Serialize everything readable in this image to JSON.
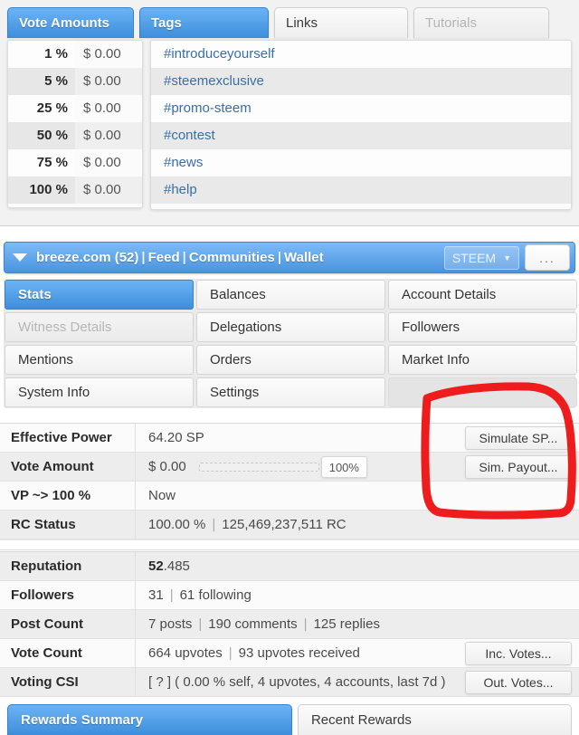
{
  "top_tabs": [
    {
      "label": "Vote Amounts",
      "state": "active"
    },
    {
      "label": "Tags",
      "state": "active"
    },
    {
      "label": "Links",
      "state": "normal"
    },
    {
      "label": "Tutorials",
      "state": "disabled"
    }
  ],
  "vote_amounts": {
    "rows": [
      {
        "percent": "1 %",
        "amount": "$ 0.00"
      },
      {
        "percent": "5 %",
        "amount": "$ 0.00"
      },
      {
        "percent": "25 %",
        "amount": "$ 0.00"
      },
      {
        "percent": "50 %",
        "amount": "$ 0.00"
      },
      {
        "percent": "75 %",
        "amount": "$ 0.00"
      },
      {
        "percent": "100 %",
        "amount": "$ 0.00"
      }
    ]
  },
  "tags": {
    "items": [
      "#introduceyourself",
      "#steemexclusive",
      "#promo-steem",
      "#contest",
      "#news",
      "#help"
    ]
  },
  "account_bar": {
    "account": "breeze.com (52)",
    "links": [
      "Feed",
      "Communities",
      "Wallet"
    ],
    "separator": "|",
    "currency_selected": "STEEM",
    "more_label": "..."
  },
  "tab_grid": [
    {
      "label": "Stats",
      "state": "active"
    },
    {
      "label": "Balances",
      "state": "normal"
    },
    {
      "label": "Account Details",
      "state": "normal"
    },
    {
      "label": "Witness Details",
      "state": "disabled"
    },
    {
      "label": "Delegations",
      "state": "normal"
    },
    {
      "label": "Followers",
      "state": "normal"
    },
    {
      "label": "Mentions",
      "state": "normal"
    },
    {
      "label": "Orders",
      "state": "normal"
    },
    {
      "label": "Market Info",
      "state": "normal"
    },
    {
      "label": "System Info",
      "state": "normal"
    },
    {
      "label": "Settings",
      "state": "normal"
    },
    {
      "label": "",
      "state": "empty"
    }
  ],
  "stats_group_1": [
    {
      "label": "Effective Power",
      "value": "64.20 SP",
      "button": "Simulate SP..."
    },
    {
      "label": "Vote Amount",
      "value": "$ 0.00",
      "slider_value": "100%",
      "button": "Sim. Payout..."
    },
    {
      "label": "VP ~> 100 %",
      "value": "Now",
      "button": null
    },
    {
      "label": "RC Status",
      "value_a": "100.00 %",
      "separator": "|",
      "value_b": "125,469,237,511 RC",
      "button": null
    }
  ],
  "stats_group_2": [
    {
      "label": "Reputation",
      "value_strong": "52",
      "value_rest": ".485",
      "button": null
    },
    {
      "label": "Followers",
      "value_a": "31",
      "separator": "|",
      "value_b": "61 following",
      "button": null
    },
    {
      "label": "Post Count",
      "value_a": "7 posts",
      "separator": "|",
      "value_b": "190 comments",
      "separator2": "|",
      "value_c": "125 replies",
      "button": null
    },
    {
      "label": "Vote Count",
      "value_a": "664 upvotes",
      "separator": "|",
      "value_b": "93 upvotes received",
      "button": "Inc. Votes..."
    },
    {
      "label": "Voting CSI",
      "value": "[ ? ] ( 0.00 % self, 4 upvotes, 4 accounts, last 7d )",
      "button": "Out. Votes..."
    }
  ],
  "bottom_tabs": [
    {
      "label": "Rewards Summary",
      "state": "active"
    },
    {
      "label": "Recent Rewards",
      "state": "normal"
    }
  ],
  "colors": {
    "accent_blue": "#3d8edb",
    "accent_blue_light": "#6cb3f5",
    "link_blue": "#3a6ea5",
    "annotation_red": "#ee1c1c",
    "row_odd": "#fbfbfb",
    "row_even": "#ededed"
  },
  "annotation": {
    "shape": "hand-drawn-red-rectangle",
    "target": "Simulate SP... / Sim. Payout... buttons"
  }
}
